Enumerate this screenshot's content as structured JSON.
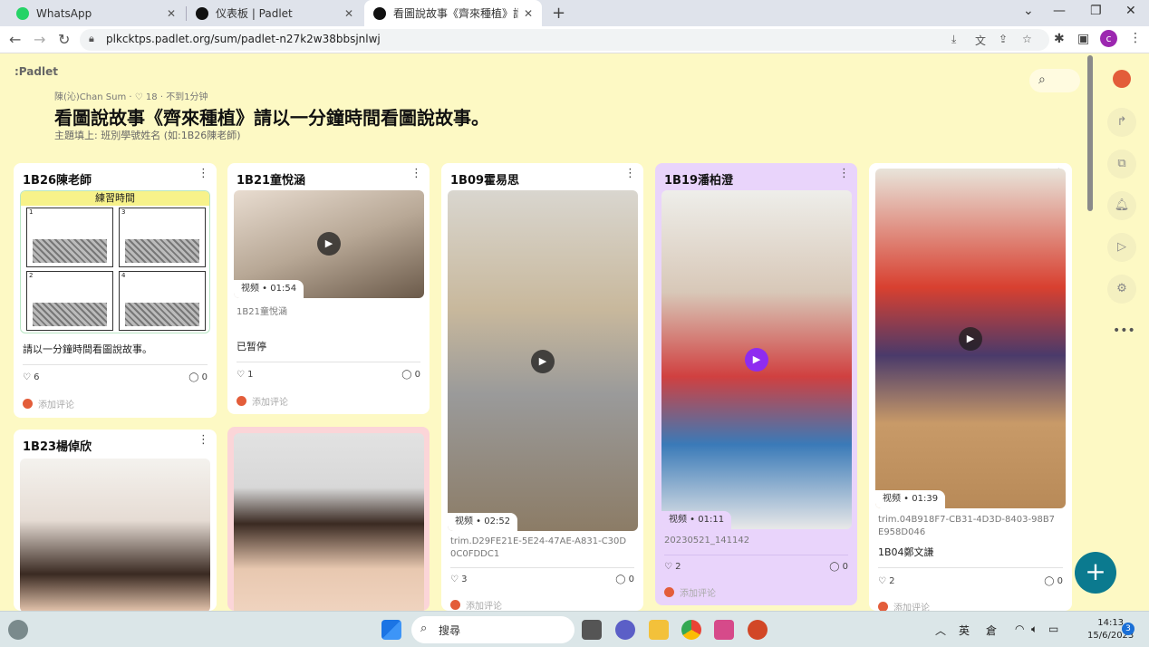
{
  "browser": {
    "tabs": [
      {
        "title": "WhatsApp",
        "color": "#25d366"
      },
      {
        "title": "仪表板 | Padlet",
        "color": "#111111"
      },
      {
        "title": "看圖說故事《齊來種植》請以一分鐘時間看",
        "color": "#111111"
      }
    ],
    "url": "plkcktps.padlet.org/sum/padlet-n27k2w38bbsjnlwj",
    "profile_initial": "c"
  },
  "padlet": {
    "logo": ":Padlet",
    "author": "陳(沁)Chan Sum",
    "likes_total": "18",
    "time_ago": "不到1分钟",
    "title": "看圖說故事《齊來種植》請以一分鐘時間看圖說故事。",
    "subtitle": "主題填上: 班別學號姓名 (如:1B26陳老師)"
  },
  "cards": {
    "c1": {
      "name": "1B26陳老師",
      "banner": "練習時間",
      "text": "請以一分鐘時間看圖說故事。",
      "likes": "6",
      "comments": "0",
      "add_comment": "添加评论"
    },
    "c2": {
      "name": "1B21童悅涵",
      "type": "视频",
      "duration": "01:54",
      "caption": "1B21童悅涵",
      "text": "已暂停",
      "likes": "1",
      "comments": "0",
      "add_comment": "添加评论"
    },
    "c3": {
      "name": "1B09霍易思",
      "type": "视频",
      "duration": "02:52",
      "caption": "trim.D29FE21E-5E24-47AE-A831-C30D0C0FDDC1",
      "likes": "3",
      "comments": "0",
      "add_comment": "添加评论"
    },
    "c4": {
      "name": "1B19潘柏澄",
      "type": "视频",
      "duration": "01:11",
      "caption": "20230521_141142",
      "likes": "2",
      "comments": "0",
      "add_comment": "添加评论"
    },
    "c5": {
      "type": "视频",
      "duration": "01:39",
      "caption": "trim.04B918F7-CB31-4D3D-8403-98B7E958D046",
      "text": "1B04鄭文謙",
      "likes": "2",
      "comments": "0",
      "add_comment": "添加评论"
    },
    "c6": {
      "name": "1B23楊倬欣"
    }
  },
  "taskbar": {
    "search_label": "搜尋",
    "ime_1": "英",
    "ime_2": "倉",
    "time": "14:13",
    "date": "15/6/2023",
    "notifications": "3"
  }
}
